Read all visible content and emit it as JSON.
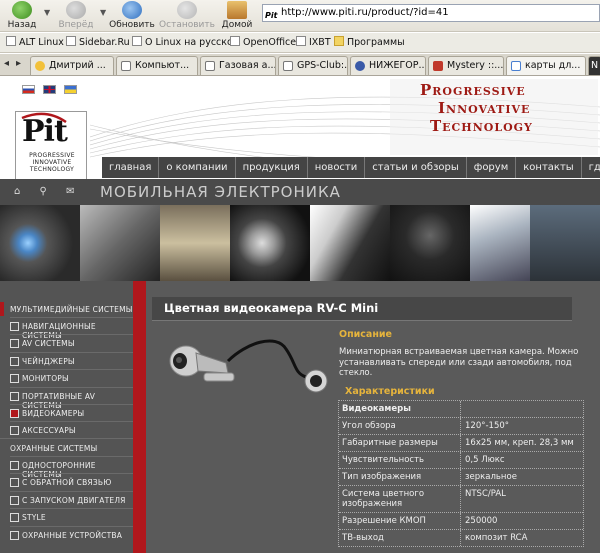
{
  "browser": {
    "nav": {
      "back": "Назад",
      "forward": "Вперёд",
      "refresh": "Обновить",
      "stop": "Остановить",
      "home": "Домой"
    },
    "address": {
      "favicon_text": "Pit",
      "url": "http://www.piti.ru/product/?id=41"
    },
    "bookmarks": [
      "ALT Linux",
      "Sidebar.Ru",
      "О Linux на русском",
      "OpenOffice",
      "IXBT",
      "Программы"
    ],
    "tabs": [
      "Дмитрий ...",
      "Компьют...",
      "Газовая а...",
      "GPS-Club:...",
      "НИЖЕГОР...",
      "Mystery ::...",
      "карты дл..."
    ],
    "tab_overflow": "N"
  },
  "site": {
    "logo_text": "Pit",
    "logo_sub": [
      "PROGRESSIVE",
      "INNOVATIVE",
      "TECHNOLOGY"
    ],
    "tagline": [
      "Progressive",
      "Innovative",
      "Technology"
    ],
    "nav": [
      "главная",
      "о компании",
      "продукция",
      "новости",
      "статьи и обзоры",
      "форум",
      "контакты",
      "где купить"
    ],
    "section_title": "МОБИЛЬНАЯ ЭЛЕКТРОНИКА",
    "sidebar": {
      "group1": "МУЛЬТИМЕДИЙНЫЕ СИСТЕМЫ",
      "items1": [
        "НАВИГАЦИОННЫЕ СИСТЕМЫ",
        "AV СИСТЕМЫ",
        "ЧЕЙНДЖЕРЫ",
        "МОНИТОРЫ",
        "ПОРТАТИВНЫЕ AV СИСТЕМЫ",
        "ВИДЕОКАМЕРЫ",
        "АКСЕССУАРЫ"
      ],
      "group2": "ОХРАННЫЕ СИСТЕМЫ",
      "items2": [
        "ОДНОСТОРОННИЕ СИСТЕМЫ",
        "С ОБРАТНОЙ СВЯЗЬЮ",
        "С ЗАПУСКОМ ДВИГАТЕЛЯ",
        "STYLE",
        "ОХРАННЫЕ УСТРОЙСТВА"
      ]
    },
    "product": {
      "title": "Цветная видеокамера RV-C Mini",
      "desc_heading": "Описание",
      "description": "Миниатюрная встраиваемая цветная камера. Можно устанавливать спереди или сзади автомобиля, под стекло.",
      "char_heading": "Характеристики",
      "spec_header": "Видеокамеры",
      "specs": [
        {
          "k": "Угол обзора",
          "v": "120°-150°"
        },
        {
          "k": "Габаритные размеры",
          "v": "16x25 мм, креп. 28,3 мм"
        },
        {
          "k": "Чувствительность",
          "v": "0,5 Люкс"
        },
        {
          "k": "Тип изображения",
          "v": "зеркальное"
        },
        {
          "k": "Система цветного изображения",
          "v": "NTSC/PAL"
        },
        {
          "k": "Разрешение КМОП",
          "v": "250000"
        },
        {
          "k": "ТВ-выход",
          "v": "композит RCA"
        }
      ]
    }
  },
  "colors": {
    "accent_red": "#b0171c",
    "heading_gold": "#e6b43c"
  }
}
